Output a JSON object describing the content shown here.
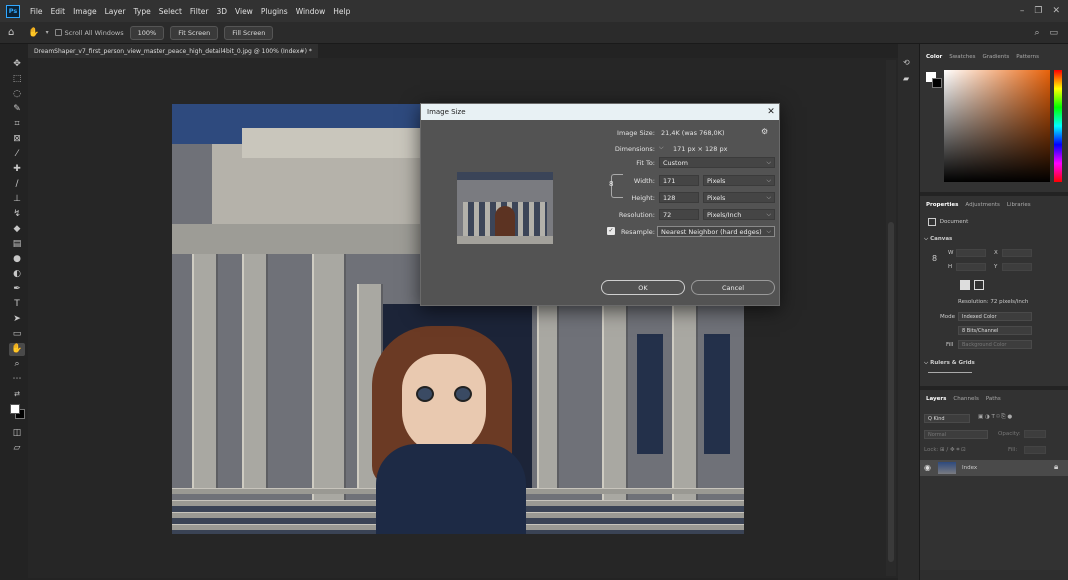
{
  "menu": {
    "logo": "Ps",
    "items": [
      "File",
      "Edit",
      "Image",
      "Layer",
      "Type",
      "Select",
      "Filter",
      "3D",
      "View",
      "Plugins",
      "Window",
      "Help"
    ],
    "window_controls": [
      "–",
      "❐",
      "✕"
    ]
  },
  "options": {
    "scroll_all_windows": "Scroll All Windows",
    "zoom_100": "100%",
    "fit_screen": "Fit Screen",
    "fill_screen": "Fill Screen"
  },
  "document": {
    "tab_title": "DreamShaper_v7_first_person_view_master_peace_high_detail4bit_0.jpg @ 100% (Index#) *"
  },
  "dialog": {
    "title": "Image Size",
    "close": "✕",
    "image_size_label": "Image Size:",
    "image_size_value": "21,4K (was 768,0K)",
    "dimensions_label": "Dimensions:",
    "dimensions_value": "171 px  ×  128 px",
    "fit_to_label": "Fit To:",
    "fit_to_value": "Custom",
    "width_label": "Width:",
    "width_value": "171",
    "width_unit": "Pixels",
    "height_label": "Height:",
    "height_value": "128",
    "height_unit": "Pixels",
    "resolution_label": "Resolution:",
    "resolution_value": "72",
    "resolution_unit": "Pixels/Inch",
    "resample_label": "Resample:",
    "resample_value": "Nearest Neighbor (hard edges)",
    "ok": "OK",
    "cancel": "Cancel"
  },
  "panels": {
    "color_tabs": [
      "Color",
      "Swatches",
      "Gradients",
      "Patterns"
    ],
    "properties_tabs": [
      "Properties",
      "Adjustments",
      "Libraries"
    ],
    "document_label": "Document",
    "canvas_label": "Canvas",
    "w_label": "W",
    "h_label": "H",
    "x_label": "X",
    "y_label": "Y",
    "resolution_text": "Resolution: 72 pixels/inch",
    "mode_label": "Mode",
    "mode_value": "Indexed Color",
    "bits_value": "8 Bits/Channel",
    "fill_label": "Fill",
    "fill_value": "Background Color",
    "rulers_label": "Rulers & Grids",
    "layers_tabs": [
      "Layers",
      "Channels",
      "Paths"
    ],
    "kind_label": "Q Kind",
    "blend_mode": "Normal",
    "opacity_label": "Opacity:",
    "lock_label": "Lock:",
    "fill_lbl2": "Fill:",
    "layer_name": "Index"
  },
  "colors": {
    "accent": "#31a8ff",
    "dialog_bg": "#535353",
    "title_bar": "#e8f1f4"
  }
}
